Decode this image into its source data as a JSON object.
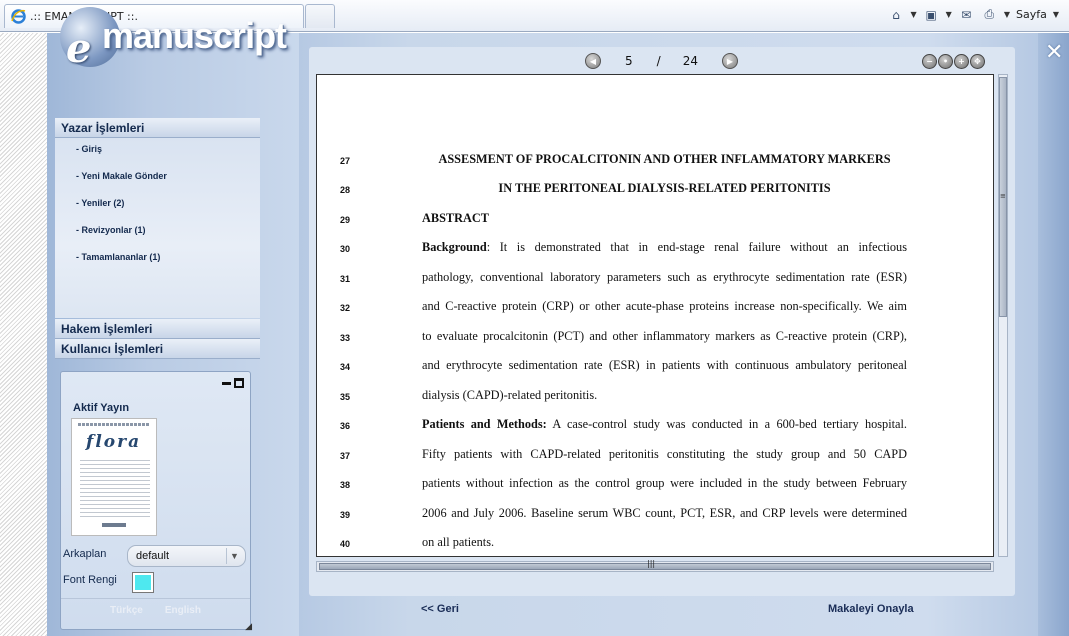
{
  "browser": {
    "tab_title": ".:: EMANUSCRIPT ::.",
    "page_menu_label": "Sayfa"
  },
  "logo": {
    "letter": "e",
    "word": "manuscript"
  },
  "sidebar": {
    "author_section": "Yazar İşlemleri",
    "author_items": [
      {
        "label": "- Giriş"
      },
      {
        "label": "- Yeni Makale Gönder"
      },
      {
        "label": "- Yeniler (2)"
      },
      {
        "label": "- Revizyonlar (1)"
      },
      {
        "label": "- Tamamlananlar (1)"
      }
    ],
    "reviewer_section": "Hakem İşlemleri",
    "user_section": "Kullanıcı İşlemleri"
  },
  "panel": {
    "active_pub_title": "Aktif Yayın",
    "journal_logo": "flora",
    "background_label": "Arkaplan",
    "background_value": "default",
    "font_color_label": "Font Rengi",
    "font_color_value": "#4ee8ef",
    "lang_tr": "Türkçe",
    "lang_en": "English"
  },
  "viewer": {
    "current_page": "5",
    "separator": "/",
    "total_pages": "24",
    "lines": [
      {
        "num": "27",
        "text": "ASSESMENT OF PROCALCITONIN AND OTHER INFLAMMATORY MARKERS"
      },
      {
        "num": "28",
        "text": "IN THE PERITONEAL DIALYSIS-RELATED PERITONITIS"
      },
      {
        "num": "29",
        "text": "ABSTRACT"
      },
      {
        "num": "30",
        "lead": "Background",
        "text": ": It is demonstrated that in end-stage renal failure without an infectious"
      },
      {
        "num": "31",
        "text": "pathology, conventional laboratory parameters such as erythrocyte sedimentation rate (ESR)"
      },
      {
        "num": "32",
        "text": "and C-reactive protein (CRP) or other acute-phase proteins increase non-specifically. We aim"
      },
      {
        "num": "33",
        "text": "to evaluate procalcitonin (PCT) and other inflammatory markers as C-reactive protein (CRP),"
      },
      {
        "num": "34",
        "text": "and erythrocyte sedimentation rate (ESR) in patients with continuous ambulatory peritoneal"
      },
      {
        "num": "35",
        "text": "dialysis (CAPD)-related peritonitis."
      },
      {
        "num": "36",
        "lead": "Patients and Methods:",
        "text": " A case-control study was conducted in a 600-bed tertiary hospital."
      },
      {
        "num": "37",
        "text": "Fifty patients with CAPD-related peritonitis constituting the study group and 50 CAPD"
      },
      {
        "num": "38",
        "text": "patients without infection as the control group were included in the study between February"
      },
      {
        "num": "39",
        "text": "2006 and July 2006. Baseline serum WBC count, PCT, ESR, and CRP levels were determined"
      },
      {
        "num": "40",
        "text": "on all patients."
      }
    ],
    "back_label": "<< Geri",
    "approve_label": "Makaleyi Onayla"
  }
}
